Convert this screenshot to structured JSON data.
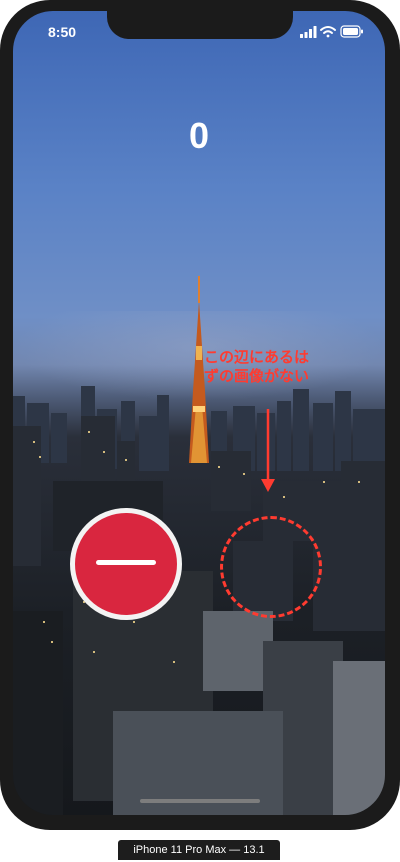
{
  "status_bar": {
    "time": "8:50"
  },
  "score": "0",
  "annotation": {
    "line1": "この辺にあるは",
    "line2": "ずの画像がない"
  },
  "device_label": "iPhone 11 Pro Max — 13.1",
  "icons": {
    "remove": "minus-circle-icon",
    "wifi": "wifi-icon",
    "battery": "battery-icon",
    "signal": "signal-icon"
  },
  "colors": {
    "annotation": "#ff3b30",
    "remove_button": "#d9263f",
    "score_text": "#ffffff"
  }
}
